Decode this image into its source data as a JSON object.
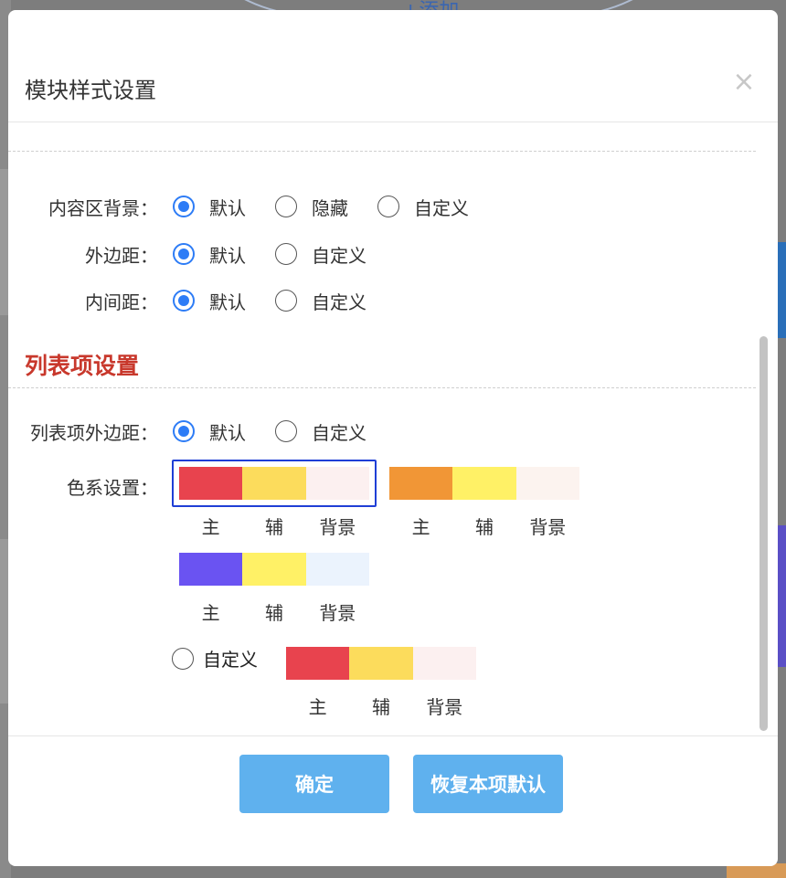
{
  "background": {
    "add_text": "+添加"
  },
  "modal": {
    "title": "模块样式设置",
    "close_label": "×",
    "rows": [
      {
        "label": "内容区背景：",
        "options": [
          {
            "label": "默认",
            "checked": true
          },
          {
            "label": "隐藏",
            "checked": false
          },
          {
            "label": "自定义",
            "checked": false
          }
        ]
      },
      {
        "label": "外边距：",
        "options": [
          {
            "label": "默认",
            "checked": true
          },
          {
            "label": "自定义",
            "checked": false
          }
        ]
      },
      {
        "label": "内间距：",
        "options": [
          {
            "label": "默认",
            "checked": true
          },
          {
            "label": "自定义",
            "checked": false
          }
        ]
      }
    ],
    "list_section": {
      "title": "列表项设置",
      "margin_row": {
        "label": "列表项外边距：",
        "options": [
          {
            "label": "默认",
            "checked": true
          },
          {
            "label": "自定义",
            "checked": false
          }
        ]
      },
      "color_row": {
        "label": "色系设置：",
        "swatch_labels": [
          "主",
          "辅",
          "背景"
        ],
        "swatches": [
          {
            "colors": [
              "#e8434e",
              "#fcdc5c",
              "#fcf0f0"
            ],
            "selected": true
          },
          {
            "colors": [
              "#f19636",
              "#fff166",
              "#fcf3ef"
            ],
            "selected": false
          },
          {
            "colors": [
              "#6a53f2",
              "#fff166",
              "#ebf3fd"
            ],
            "selected": false
          }
        ],
        "custom": {
          "label": "自定义",
          "checked": false,
          "colors": [
            "#e8434e",
            "#fcdc5c",
            "#fcf0f0"
          ]
        }
      }
    },
    "footer": {
      "confirm_label": "确定",
      "reset_label": "恢复本项默认"
    }
  },
  "colors": {
    "accent": "#2d7cf6",
    "section_title": "#c8382c",
    "button": "#5fb1ee",
    "selected_border": "#1f3fd6"
  }
}
